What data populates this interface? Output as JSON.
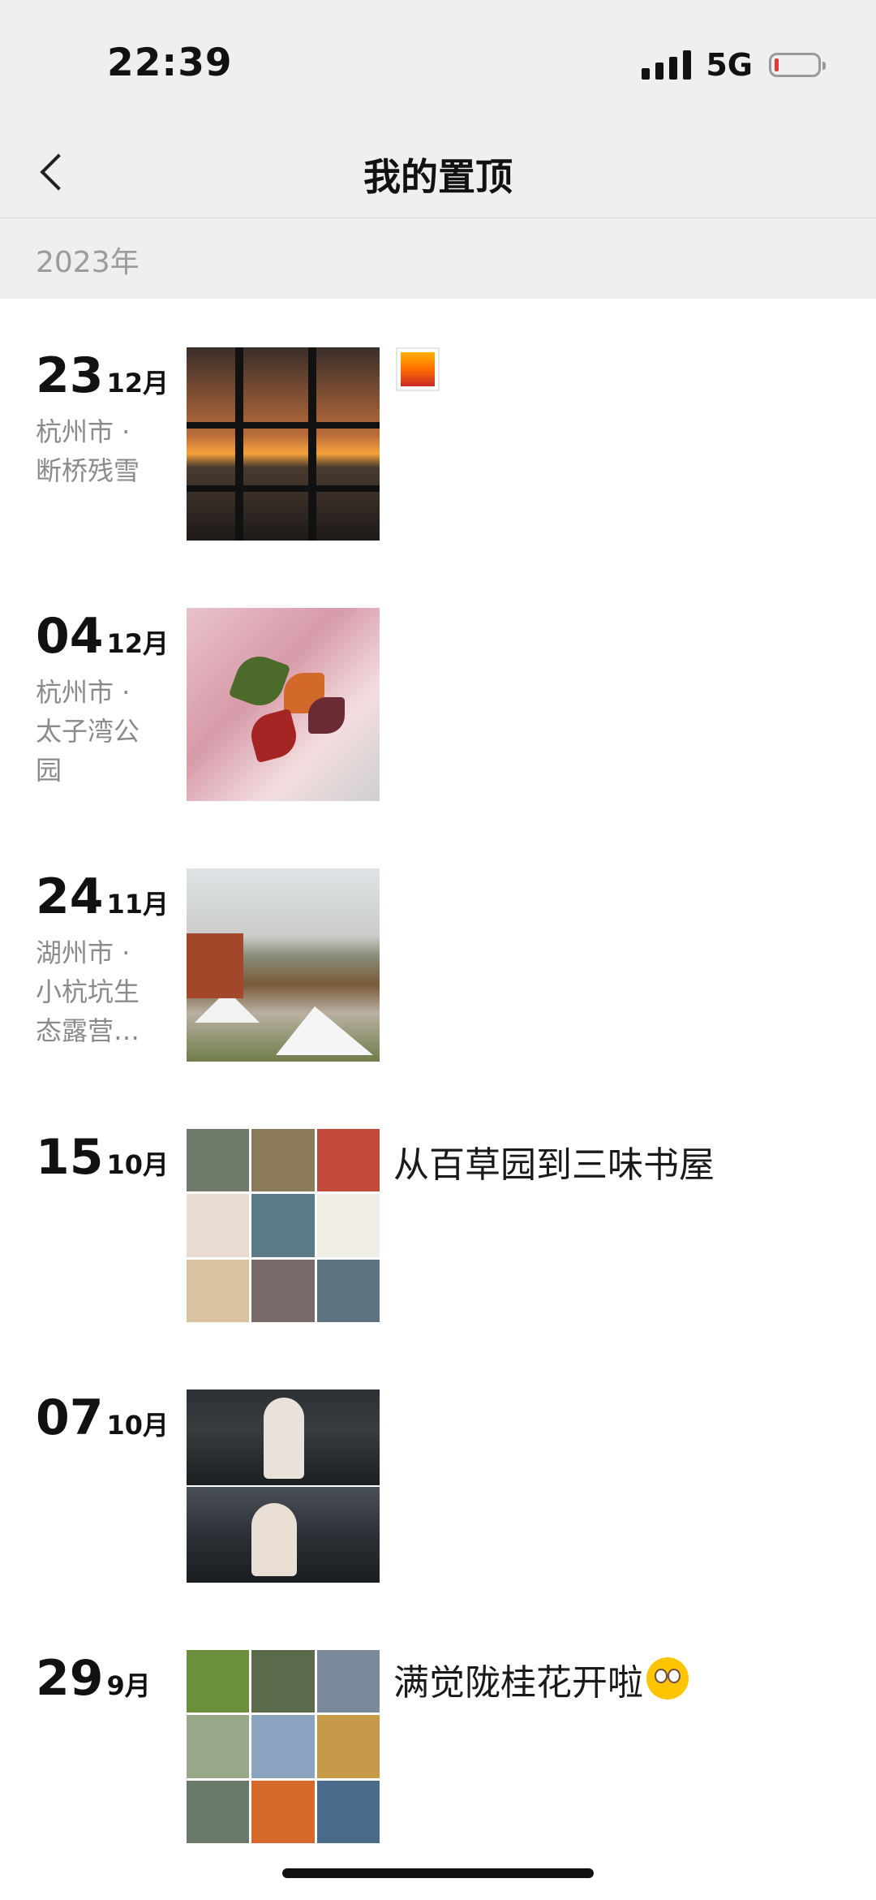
{
  "status_bar": {
    "time": "22:39",
    "network": "5G"
  },
  "nav": {
    "title": "我的置顶"
  },
  "section": {
    "year": "2023年"
  },
  "entries": [
    {
      "day": "23",
      "month": "12月",
      "location_line1": "杭州市 ·",
      "location_line2": "断桥残雪",
      "location_line3": "",
      "caption": "",
      "thumb": "sunset-window"
    },
    {
      "day": "04",
      "month": "12月",
      "location_line1": "杭州市 ·",
      "location_line2": "太子湾公",
      "location_line3": "园",
      "caption": "",
      "thumb": "maple-leaves"
    },
    {
      "day": "24",
      "month": "11月",
      "location_line1": "湖州市 ·",
      "location_line2": "小杭坑生",
      "location_line3": "态露营…",
      "caption": "",
      "thumb": "campsite"
    },
    {
      "day": "15",
      "month": "10月",
      "location_line1": "",
      "location_line2": "",
      "location_line3": "",
      "caption": "从百草园到三味书屋",
      "thumb": "grid-9"
    },
    {
      "day": "07",
      "month": "10月",
      "location_line1": "",
      "location_line2": "",
      "location_line3": "",
      "caption": "",
      "thumb": "split-2"
    },
    {
      "day": "29",
      "month": "9月",
      "location_line1": "",
      "location_line2": "",
      "location_line3": "",
      "caption": "满觉陇桂花开啦",
      "thumb": "grid-9"
    }
  ],
  "colors": {
    "header_bg": "#efefef",
    "accent_battery_low": "#e53935"
  }
}
